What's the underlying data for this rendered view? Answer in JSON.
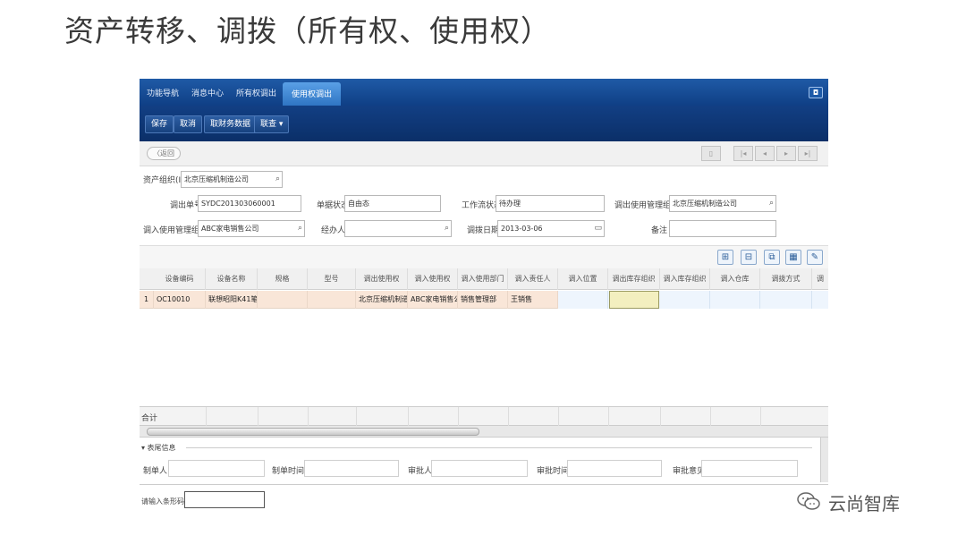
{
  "slide_title": "资产转移、调拨（所有权、使用权）",
  "tabs": [
    "功能导航",
    "消息中心",
    "所有权调出",
    "使用权调出"
  ],
  "window_button": "◘",
  "toolbar": {
    "save": "保存",
    "cancel": "取消",
    "fetch": "取财务数据",
    "link": "联查 ▾"
  },
  "nav": {
    "back": "〈返回"
  },
  "form": {
    "asset_org_label": "资产组织(I)",
    "asset_org_value": "北京压缩机制造公司",
    "out_no_label": "调出单号",
    "out_no_value": "SYDC201303060001",
    "doc_status_label": "单据状态",
    "doc_status_value": "自由态",
    "workflow_label": "工作流状态",
    "workflow_value": "待办理",
    "out_org_label": "调出使用管理组织",
    "out_org_value": "北京压缩机制造公司",
    "in_org_label": "调入使用管理组织",
    "in_org_value": "ABC家电销售公司",
    "handler_label": "经办人",
    "handler_value": "",
    "date_label": "调拨日期",
    "date_value": "2013-03-06",
    "remark_label": "备注",
    "remark_value": ""
  },
  "grid": {
    "headers": [
      "设备编码",
      "设备名称",
      "规格",
      "型号",
      "调出使用权",
      "调入使用权",
      "调入使用部门",
      "调入责任人",
      "调入位置",
      "调出库存组织",
      "调入库存组织",
      "调入仓库",
      "调拨方式",
      "调"
    ],
    "row": {
      "index": "1",
      "code": "OC10010",
      "name": "联想昭阳K41笔...",
      "spec": "",
      "model": "",
      "out_right": "北京压缩机制造...",
      "in_right": "ABC家电销售公...",
      "in_dept": "销售管理部",
      "in_person": "王销售"
    },
    "sum_label": "合计"
  },
  "footer": {
    "section": "▾ 表尾信息",
    "creator": "制单人",
    "create_time": "制单时间",
    "approver": "审批人",
    "approve_time": "审批时间",
    "approve_opinion": "审批意见",
    "barcode_label": "请输入条形码"
  },
  "watermark": "云尚智库"
}
